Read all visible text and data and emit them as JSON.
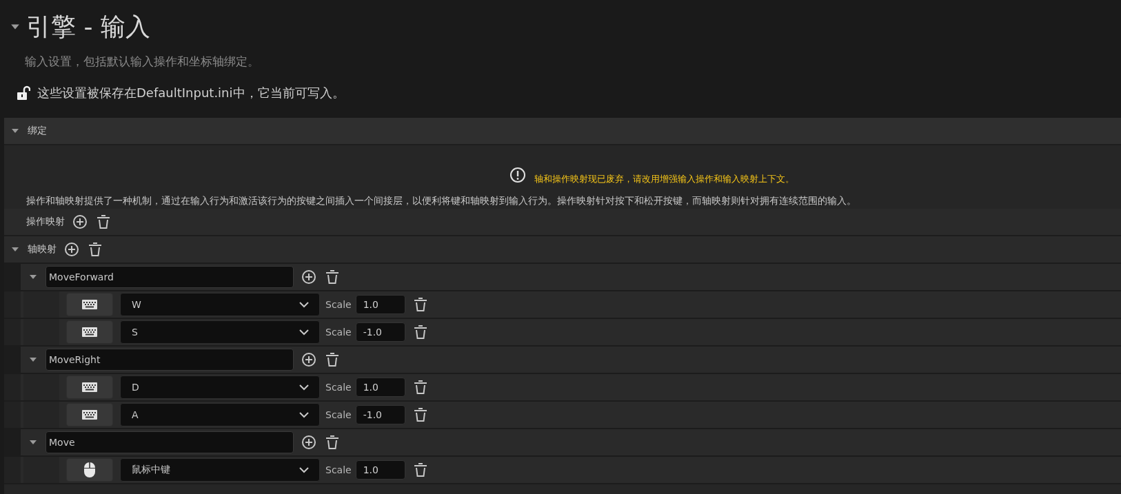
{
  "header": {
    "title": "引擎 - 输入",
    "expanded": true,
    "subtitle": "输入设置，包括默认输入操作和坐标轴绑定。",
    "file_notice": "这些设置被保存在DefaultInput.ini中，它当前可写入。"
  },
  "section": {
    "title": "绑定",
    "expanded": true,
    "warning": "轴和操作映射现已废弃，请改用增强输入操作和输入映射上下文。",
    "description": "操作和轴映射提供了一种机制，通过在输入行为和激活该行为的按键之间插入一个间接层，以便利将键和轴映射到输入行为。操作映射针对按下和松开按键，而轴映射则针对拥有连续范围的输入。",
    "action_mappings": {
      "label": "操作映射"
    },
    "axis_mappings": {
      "label": "轴映射",
      "expanded": true,
      "items": [
        {
          "name": "MoveForward",
          "expanded": true,
          "keys": [
            {
              "kind": "keyboard",
              "key": "W",
              "scale_label": "Scale",
              "scale": "1.0"
            },
            {
              "kind": "keyboard",
              "key": "S",
              "scale_label": "Scale",
              "scale": "-1.0"
            }
          ]
        },
        {
          "name": "MoveRight",
          "expanded": true,
          "keys": [
            {
              "kind": "keyboard",
              "key": "D",
              "scale_label": "Scale",
              "scale": "1.0"
            },
            {
              "kind": "keyboard",
              "key": "A",
              "scale_label": "Scale",
              "scale": "-1.0"
            }
          ]
        },
        {
          "name": "Move",
          "expanded": true,
          "keys": [
            {
              "kind": "mouse",
              "key": "鼠标中键",
              "scale_label": "Scale",
              "scale": "1.0"
            }
          ]
        }
      ]
    }
  }
}
